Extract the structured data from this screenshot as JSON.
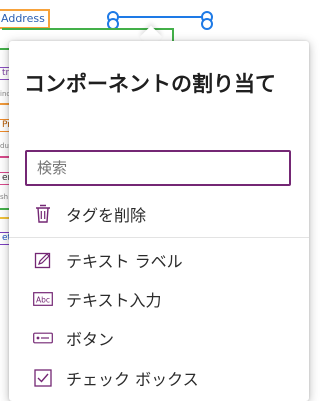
{
  "canvas": {
    "address_label": "Address",
    "left_fragments": [
      "try",
      "ince",
      "Pro",
      "duct",
      "er",
      "sh",
      "et"
    ]
  },
  "popup": {
    "title": "コンポーネントの割り当て",
    "search": {
      "placeholder": "検索",
      "value": ""
    },
    "remove_tag": {
      "label": "タグを削除",
      "icon": "trash-icon"
    },
    "items": [
      {
        "label": "テキスト ラベル",
        "icon": "text-label-icon"
      },
      {
        "label": "テキスト入力",
        "icon": "text-input-icon"
      },
      {
        "label": "ボタン",
        "icon": "button-icon"
      },
      {
        "label": "チェック ボックス",
        "icon": "checkbox-icon"
      }
    ]
  },
  "colors": {
    "accent": "#742774",
    "selection": "#1e7ae6",
    "address_border": "#f7a23b",
    "frame_green": "#43b049"
  }
}
